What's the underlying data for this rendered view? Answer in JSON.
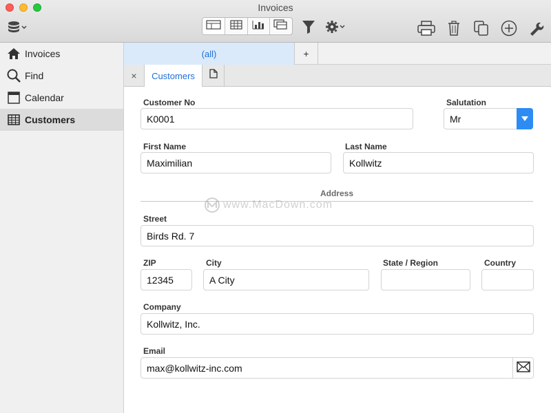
{
  "window": {
    "title": "Invoices"
  },
  "toolbar": {
    "database_icon": "database-icon",
    "view_modes": [
      "form-view-icon",
      "table-view-icon",
      "chart-view-icon",
      "card-view-icon"
    ],
    "active_view_mode": "form-view-icon",
    "filter_icon": "filter-icon",
    "settings_icon": "gear-icon",
    "right_icons": [
      "print-icon",
      "trash-icon",
      "duplicate-icon",
      "add-icon",
      "wrench-icon"
    ]
  },
  "sidebar": {
    "items": [
      {
        "label": "Invoices",
        "icon": "home-icon",
        "selected": false
      },
      {
        "label": "Find",
        "icon": "search-icon",
        "selected": false
      },
      {
        "label": "Calendar",
        "icon": "calendar-icon",
        "selected": false
      },
      {
        "label": "Customers",
        "icon": "grid-icon",
        "selected": true
      }
    ]
  },
  "tabs": {
    "filter_tab": "(all)",
    "add_tab": "+",
    "close": "×",
    "record_tab": "Customers"
  },
  "form": {
    "customer_no": {
      "label": "Customer No",
      "value": "K0001"
    },
    "salutation": {
      "label": "Salutation",
      "value": "Mr"
    },
    "first_name": {
      "label": "First Name",
      "value": "Maximilian"
    },
    "last_name": {
      "label": "Last Name",
      "value": "Kollwitz"
    },
    "address_section": "Address",
    "street": {
      "label": "Street",
      "value": "Birds Rd. 7"
    },
    "zip": {
      "label": "ZIP",
      "value": "12345"
    },
    "city": {
      "label": "City",
      "value": "A City"
    },
    "state": {
      "label": "State / Region",
      "value": ""
    },
    "country": {
      "label": "Country",
      "value": ""
    },
    "company": {
      "label": "Company",
      "value": "Kollwitz, Inc."
    },
    "email": {
      "label": "Email",
      "value": "max@kollwitz-inc.com"
    }
  },
  "watermark": "www.MacDown.com",
  "colors": {
    "accent": "#2c8cf4",
    "tab_text": "#1e6fd9",
    "tab_highlight": "#dbeafb"
  }
}
